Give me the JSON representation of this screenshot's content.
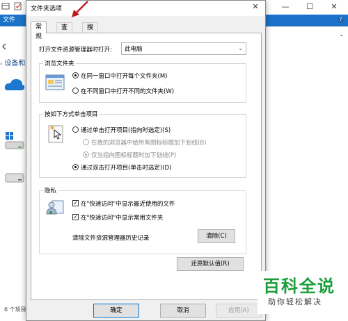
{
  "background": {
    "ribbon_file_label": "文件",
    "section_label": "设备和",
    "status_text": "6 个项目",
    "window_controls": [
      "—",
      "☐",
      "✕"
    ]
  },
  "dialog": {
    "title": "文件夹选项",
    "close_glyph": "✕",
    "tabs": [
      {
        "label": "常规",
        "active": true
      },
      {
        "label": "查看",
        "active": false
      },
      {
        "label": "搜索",
        "active": false
      }
    ],
    "open_explorer_label": "打开文件资源管理器时打开:",
    "open_explorer_value": "此电脑",
    "browse_group": {
      "title": "浏览文件夹",
      "options": [
        {
          "label": "在同一窗口中打开每个文件夹(M)",
          "selected": true
        },
        {
          "label": "在不同窗口中打开不同的文件夹(W)",
          "selected": false
        }
      ]
    },
    "click_group": {
      "title": "按如下方式单击项目",
      "options": [
        {
          "label": "通过单击打开项目(指向时选定)(S)",
          "selected": false,
          "disabled": false
        },
        {
          "label": "在我的浏览器中给所有图标标题加下划线(B)",
          "selected": false,
          "disabled": true
        },
        {
          "label": "仅当指向图标标题时加下划线(P)",
          "selected": true,
          "disabled": true
        },
        {
          "label": "通过双击打开项目(单击时选定)(D)",
          "selected": true,
          "disabled": false
        }
      ]
    },
    "privacy_group": {
      "title": "隐私",
      "checkboxes": [
        {
          "label": "在\"快速访问\"中显示最近使用的文件",
          "checked": true
        },
        {
          "label": "在\"快速访问\"中显示常用文件夹",
          "checked": true
        }
      ],
      "clear_label": "清除文件资源管理器历史记录",
      "clear_button": "清除(C)"
    },
    "restore_button": "还原默认值(R)",
    "footer_buttons": {
      "ok": "确定",
      "cancel": "取消",
      "apply": "应用(A)"
    }
  },
  "watermark": {
    "title": "百科全说",
    "subtitle": "助你轻松解决"
  },
  "colors": {
    "ribbon": "#1a73c8",
    "annotation_arrow": "#c0181e",
    "watermark_green": "#1a9e3a",
    "primary_button_border": "#0078d7"
  }
}
